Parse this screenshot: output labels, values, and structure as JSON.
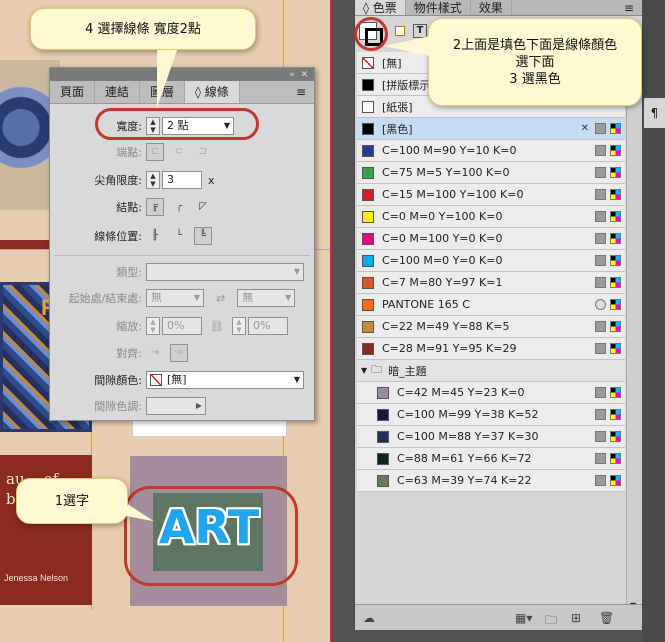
{
  "canvas": {
    "quote_text": "au... of broken\"",
    "author": "Jenessa Nelson",
    "mosaic_text": "RUS",
    "art_text": "ART"
  },
  "callouts": {
    "width_step": "4 選擇線條 寬度2點",
    "fill_stroke_step_line1": "2上面是填色下面是線條顏色",
    "fill_stroke_step_line2": "選下面",
    "fill_stroke_step_line3": "3  選黑色",
    "select_text_step": "1選字"
  },
  "stroke_panel": {
    "tabs": [
      "頁面",
      "連結",
      "圖層",
      "◊ 線條"
    ],
    "menu_icon": "≡",
    "weight_label": "寬度:",
    "weight_value": "2 點",
    "cap_label": "端點:",
    "miter_label": "尖角限度:",
    "miter_value": "3",
    "miter_unit": "x",
    "join_label": "結點:",
    "align_label": "線條位置:",
    "type_label": "類型:",
    "start_end_label": "起始處/結束處:",
    "start_value": "無",
    "end_value": "無",
    "scale_label": "縮放:",
    "scale_start": "0%",
    "scale_end": "0%",
    "align_arrow_label": "對齊:",
    "gap_color_label": "間隙顏色:",
    "gap_color_value": "[無]",
    "gap_tint_label": "間隙色調:"
  },
  "swatches_panel": {
    "tabs": [
      "◊ 色票",
      "物件樣式",
      "效果"
    ],
    "swatches": [
      {
        "name": "[無]",
        "color": "none",
        "icons": []
      },
      {
        "name": "[拼版標示色]",
        "color": "#000000",
        "icons": []
      },
      {
        "name": "[紙張]",
        "color": "#ffffff",
        "icons": []
      },
      {
        "name": "[黑色]",
        "color": "#000000",
        "icons": [
          "x",
          "gray",
          "cmyk"
        ],
        "selected": true
      },
      {
        "name": "C=100 M=90 Y=10 K=0",
        "color": "#2a3a8f",
        "icons": [
          "gray",
          "cmyk"
        ]
      },
      {
        "name": "C=75 M=5 Y=100 K=0",
        "color": "#3aa349",
        "icons": [
          "gray",
          "cmyk"
        ]
      },
      {
        "name": "C=15 M=100 Y=100 K=0",
        "color": "#d21f26",
        "icons": [
          "gray",
          "cmyk"
        ]
      },
      {
        "name": "C=0 M=0 Y=100 K=0",
        "color": "#fff200",
        "icons": [
          "gray",
          "cmyk"
        ]
      },
      {
        "name": "C=0 M=100 Y=0 K=0",
        "color": "#ec008c",
        "icons": [
          "gray",
          "cmyk"
        ]
      },
      {
        "name": "C=100 M=0 Y=0 K=0",
        "color": "#00aeef",
        "icons": [
          "gray",
          "cmyk"
        ]
      },
      {
        "name": "C=7 M=80 Y=97 K=1",
        "color": "#e2532a",
        "icons": [
          "gray",
          "cmyk"
        ]
      },
      {
        "name": "PANTONE 165 C",
        "color": "#ff6a13",
        "icons": [
          "spot",
          "cmyk"
        ]
      },
      {
        "name": "C=22 M=49 Y=88 K=5",
        "color": "#c28a3a",
        "icons": [
          "gray",
          "cmyk"
        ]
      },
      {
        "name": "C=28 M=91 Y=95 K=29",
        "color": "#8a2a1f",
        "icons": [
          "gray",
          "cmyk"
        ]
      }
    ],
    "group_name": "暗_主題",
    "group_swatches": [
      {
        "name": "C=42 M=45 Y=23 K=0",
        "color": "#9a8aa2"
      },
      {
        "name": "C=100 M=99 Y=38 K=52",
        "color": "#1a1840"
      },
      {
        "name": "C=100 M=88 Y=37 K=30",
        "color": "#1f2f5c"
      },
      {
        "name": "C=88 M=61 Y=66 K=72",
        "color": "#0f2520"
      },
      {
        "name": "C=63 M=39 Y=74 K=22",
        "color": "#667a55"
      }
    ]
  },
  "colors": {
    "highlight": "#c0392b",
    "callout_bg": "#fff8d2",
    "selected_row": "#c6dcf5"
  }
}
